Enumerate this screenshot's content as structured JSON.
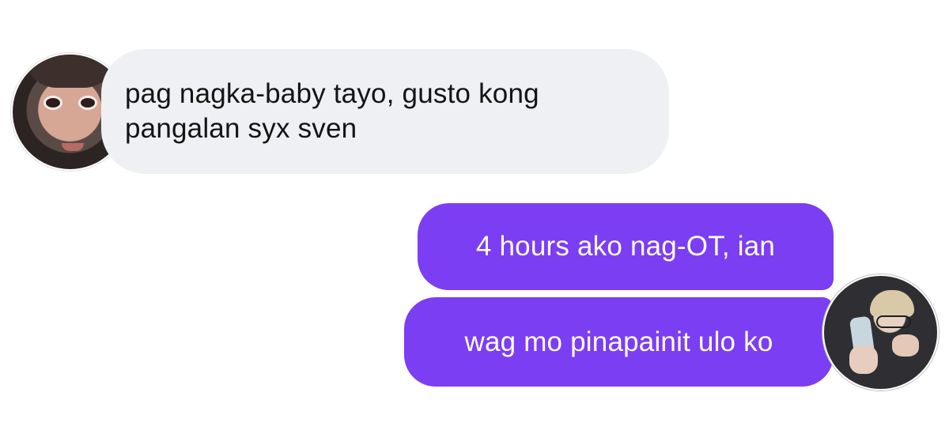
{
  "conversation": {
    "incoming": {
      "lines": [
        "pag nagka-baby tayo, gusto kong",
        "pangalan syx sven"
      ],
      "bubble_color": "#eef0f3",
      "text_color": "#141414",
      "avatar": "sender-avatar-photo"
    },
    "outgoing": [
      {
        "text": "4 hours ako nag-OT, ian"
      },
      {
        "text": "wag mo pinapainit ulo ko"
      }
    ],
    "outgoing_bubble_color": "#7b3ef2",
    "outgoing_text_color": "#ffffff",
    "outgoing_avatar": "user-avatar-photo"
  }
}
